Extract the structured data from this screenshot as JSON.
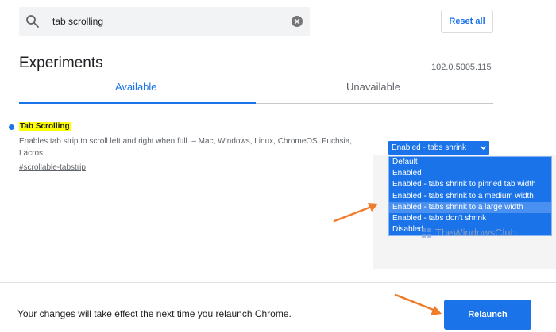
{
  "search": {
    "value": "tab scrolling"
  },
  "header": {
    "reset_label": "Reset all"
  },
  "page": {
    "title": "Experiments",
    "version": "102.0.5005.115"
  },
  "tabs": [
    {
      "label": "Available",
      "active": true
    },
    {
      "label": "Unavailable",
      "active": false
    }
  ],
  "experiment": {
    "name": "Tab Scrolling",
    "description": "Enables tab strip to scroll left and right when full. – Mac, Windows, Linux, ChromeOS, Fuchsia, Lacros",
    "link": "#scrollable-tabstrip",
    "selected": "Enabled - tabs shrink",
    "options": [
      "Default",
      "Enabled",
      "Enabled - tabs shrink to pinned tab width",
      "Enabled - tabs shrink to a medium width",
      "Enabled - tabs shrink to a large width",
      "Enabled - tabs don't shrink",
      "Disabled"
    ],
    "highlighted_option_index": 4
  },
  "watermark": {
    "text": "TheWindowsClub"
  },
  "footer": {
    "notice": "Your changes will take effect the next time you relaunch Chrome.",
    "relaunch_label": "Relaunch"
  },
  "colors": {
    "accent": "#1a73e8",
    "highlight": "#ffff00",
    "annotation_arrow": "#f07c2a"
  }
}
